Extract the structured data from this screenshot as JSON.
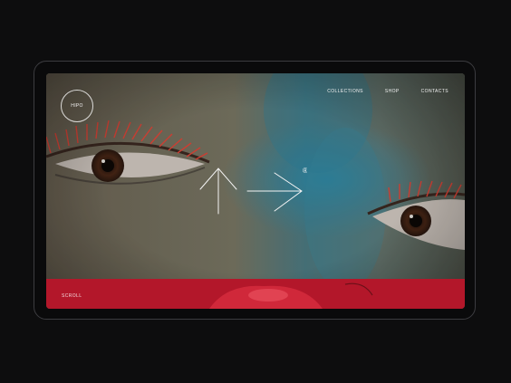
{
  "brand": {
    "logo_text": "HIPO"
  },
  "nav": {
    "items": [
      "COLLECTIONS",
      "SHOP",
      "CONTACTS"
    ]
  },
  "hero": {
    "registered_mark": "®"
  },
  "footer_band": {
    "scroll_label": "SCROLL"
  },
  "colors": {
    "background": "#0d0d0e",
    "band_red": "#b3172a",
    "text_light": "#f2f2f2"
  }
}
